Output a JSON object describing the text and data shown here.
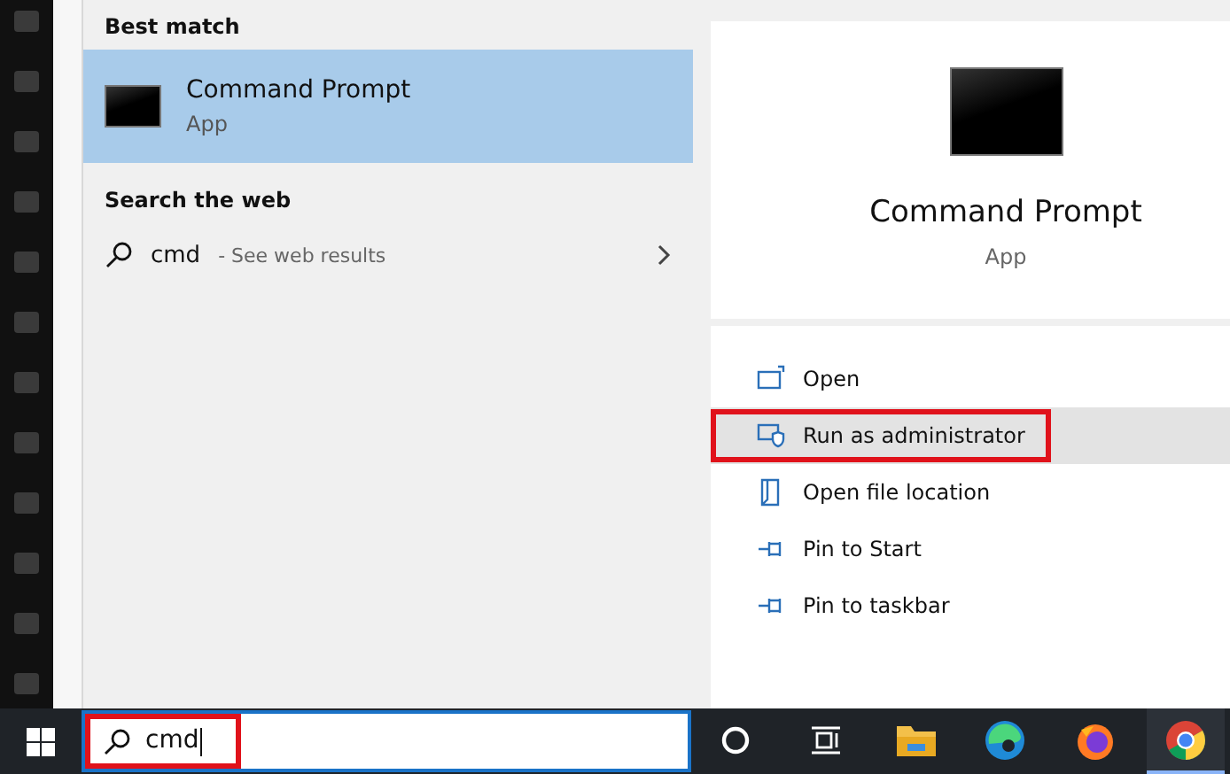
{
  "best_match": {
    "heading": "Best match",
    "item": {
      "title": "Command Prompt",
      "subtitle": "App",
      "selected": true
    }
  },
  "web": {
    "heading": "Search the web",
    "item": {
      "query": "cmd",
      "hint": "- See web results"
    }
  },
  "details": {
    "title": "Command Prompt",
    "subtitle": "App",
    "actions": [
      {
        "kind": "open",
        "label": "Open",
        "selected": false,
        "highlighted": false
      },
      {
        "kind": "admin",
        "label": "Run as administrator",
        "selected": true,
        "highlighted": true
      },
      {
        "kind": "folder",
        "label": "Open file location",
        "selected": false,
        "highlighted": false
      },
      {
        "kind": "pin",
        "label": "Pin to Start",
        "selected": false,
        "highlighted": false
      },
      {
        "kind": "pin",
        "label": "Pin to taskbar",
        "selected": false,
        "highlighted": false
      }
    ]
  },
  "taskbar": {
    "search": {
      "value": "cmd",
      "highlighted": true
    },
    "apps": [
      {
        "kind": "cortana",
        "active": false
      },
      {
        "kind": "taskview",
        "active": false
      },
      {
        "kind": "explorer",
        "active": false
      },
      {
        "kind": "edge",
        "active": false
      },
      {
        "kind": "firefox",
        "active": false
      },
      {
        "kind": "chrome",
        "active": true
      }
    ]
  }
}
